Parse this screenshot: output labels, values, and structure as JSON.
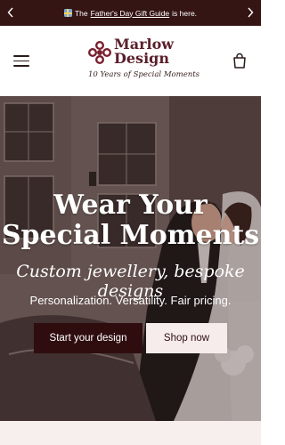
{
  "announcement": {
    "prefix": "The",
    "link_text": "Father's Day Gift Guide",
    "suffix": "is here."
  },
  "header": {
    "logo": {
      "line1": "Marlow",
      "line2": "Design",
      "tagline": "10 Years of Special Moments"
    }
  },
  "hero": {
    "headline_line1": "Wear Your",
    "headline_line2": "Special Moments",
    "script": "Custom jewellery, bespoke designs",
    "subtext": "Personalization. Versatility. Fair pricing.",
    "primary_button": "Start your design",
    "secondary_button": "Shop now"
  },
  "colors": {
    "brand_dark": "#351414",
    "button_dark": "#2f0d0f",
    "button_light": "#f7ecec",
    "logo": "#5a1f2a"
  }
}
